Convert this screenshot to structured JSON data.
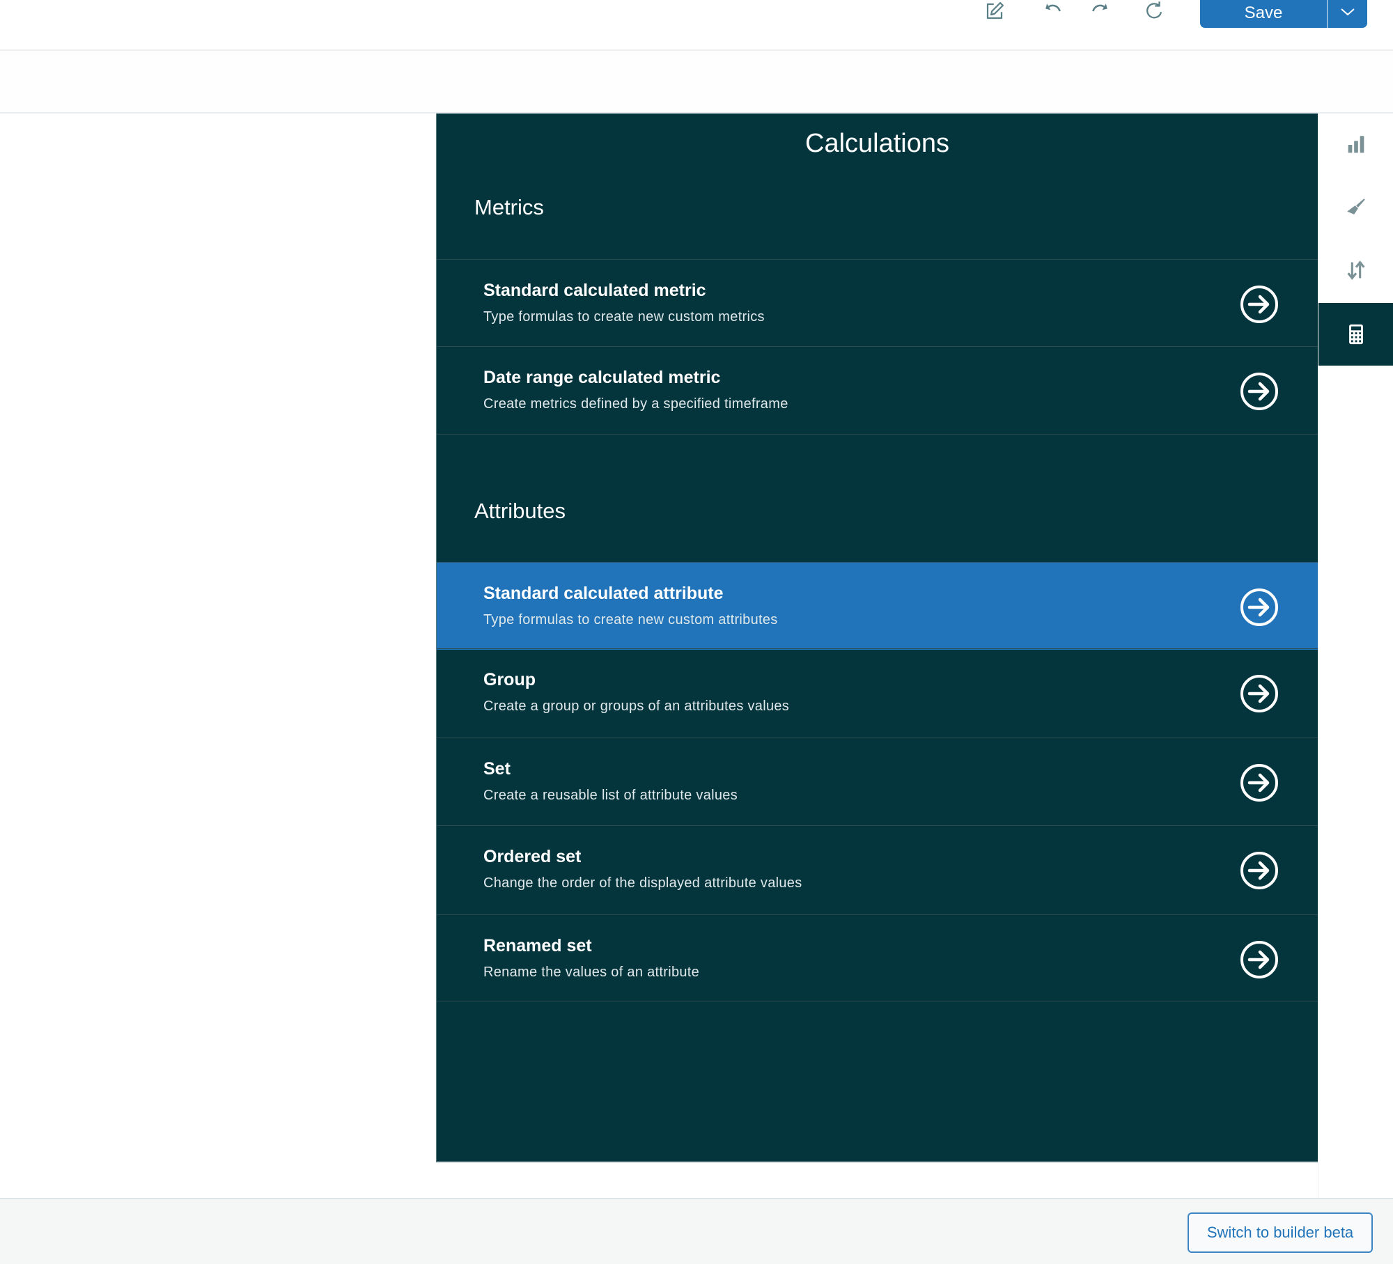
{
  "toolbar": {
    "icons": [
      "edit-icon",
      "undo-icon",
      "redo-icon",
      "refresh-icon"
    ],
    "save_label": "Save",
    "save_dropdown_icon": "chevron-down-icon",
    "colors": {
      "primary": "#2174b9",
      "icon": "#5a7f86"
    }
  },
  "panel": {
    "title": "Calculations",
    "background": "#04353d",
    "sections": [
      {
        "title": "Metrics",
        "items": [
          {
            "title": "Standard calculated metric",
            "subtitle": "Type formulas to create new custom metrics",
            "selected": false
          },
          {
            "title": "Date range calculated metric",
            "subtitle": "Create metrics defined by a specified timeframe",
            "selected": false
          }
        ]
      },
      {
        "title": "Attributes",
        "items": [
          {
            "title": "Standard calculated attribute",
            "subtitle": "Type formulas to create new custom attributes",
            "selected": true
          },
          {
            "title": "Group",
            "subtitle": "Create a group or groups of an attributes values",
            "selected": false
          },
          {
            "title": "Set",
            "subtitle": "Create a reusable list of attribute values",
            "selected": false
          },
          {
            "title": "Ordered set",
            "subtitle": "Change the order of the displayed attribute values",
            "selected": false
          },
          {
            "title": "Renamed set",
            "subtitle": "Rename the values of an attribute",
            "selected": false
          }
        ]
      }
    ],
    "item_icon": "arrow-right-circle-icon"
  },
  "rail": {
    "items": [
      {
        "icon": "bar-chart-icon",
        "active": false
      },
      {
        "icon": "paintbrush-icon",
        "active": false
      },
      {
        "icon": "sort-icon",
        "active": false
      },
      {
        "icon": "calculator-icon",
        "active": true
      }
    ]
  },
  "footer": {
    "switch_label": "Switch to builder beta"
  }
}
